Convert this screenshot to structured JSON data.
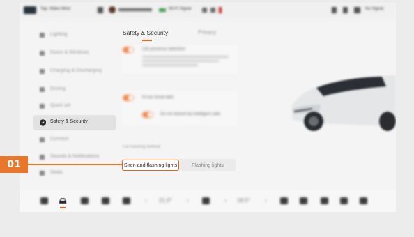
{
  "statusbar": {
    "left_text": "Tap. Wake Mind",
    "center_text": "Wi-Fi Signal",
    "right_text": "No Signal"
  },
  "sidebar": {
    "items": [
      {
        "label": "Lighting",
        "icon": "light-icon"
      },
      {
        "label": "Doors & Windows",
        "icon": "door-icon"
      },
      {
        "label": "Charging & Discharging",
        "icon": "charging-icon"
      },
      {
        "label": "Driving",
        "icon": "steering-icon"
      },
      {
        "label": "Quick set",
        "icon": "quick-icon"
      },
      {
        "label": "Safety & Security",
        "icon": "shield-icon",
        "active": true
      },
      {
        "label": "Connect",
        "icon": "connect-icon"
      },
      {
        "label": "Sounds & Notifications",
        "icon": "sound-icon"
      },
      {
        "label": "Seats",
        "icon": "seat-icon"
      }
    ]
  },
  "tabs": {
    "active": "Safety & Security",
    "inactive": "Privacy"
  },
  "cards": {
    "card1_title": "Life presence detection",
    "card2_title": "In-car visual aids",
    "card2_sub": "Do not disturb by intelligent calls"
  },
  "warning": {
    "label": "Car tracking method",
    "options": [
      "Siren and flashing lights",
      "Flashing lights"
    ],
    "selected": "Siren and flashing lights"
  },
  "dock": {
    "temp_left": "21.0°",
    "temp_right": "18.5°"
  },
  "callout": {
    "number": "01"
  },
  "colors": {
    "accent": "#e8762b",
    "selected_border": "#e2612a"
  }
}
